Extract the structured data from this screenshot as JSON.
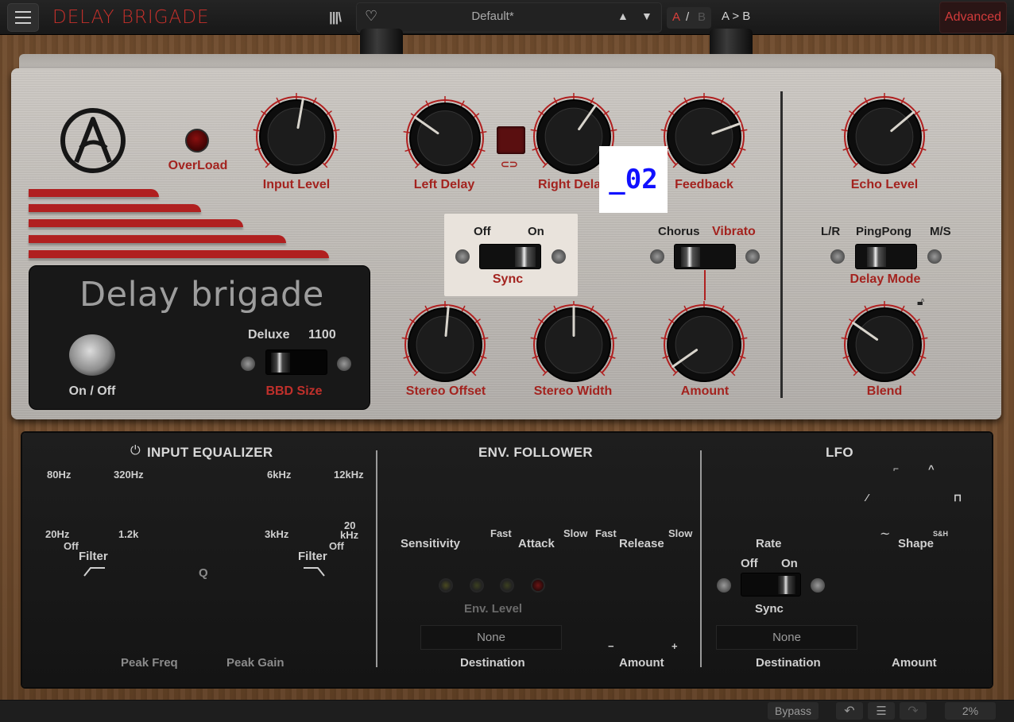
{
  "header": {
    "menu_icon": "hamburger-icon",
    "app_title": "DELAY BRIGADE",
    "library_icon": "library-icon",
    "favorite_icon": "heart-icon",
    "preset_name": "Default*",
    "prev_preset": "▲",
    "next_preset": "▼",
    "ab_a": "A",
    "ab_sep": "/",
    "ab_b": "B",
    "ab_copy": "A > B",
    "advanced": "Advanced"
  },
  "pedal": {
    "overload_label": "OverLoad",
    "input_level_label": "Input Level",
    "left_delay_label": "Left Delay",
    "right_delay_label": "Right Delay",
    "feedback_label": "Feedback",
    "echo_level_label": "Echo Level",
    "highlight_overlay": "_02",
    "sync": {
      "off": "Off",
      "on": "On",
      "label": "Sync"
    },
    "chorus": {
      "left": "Chorus",
      "right": "Vibrato"
    },
    "delay_mode": {
      "lr": "L/R",
      "pingpong": "PingPong",
      "ms": "M/S",
      "label": "Delay Mode"
    },
    "brand_title": "Delay brigade",
    "on_off_label": "On / Off",
    "bbd": {
      "deluxe": "Deluxe",
      "n1100": "1100",
      "label": "BBD Size"
    },
    "stereo_offset_label": "Stereo Offset",
    "stereo_width_label": "Stereo Width",
    "amount_label": "Amount",
    "blend_label": "Blend"
  },
  "input_eq": {
    "title": "INPUT EQUALIZER",
    "lo_80": "80Hz",
    "lo_320": "320Hz",
    "lo_20": "20Hz",
    "lo_off": "Off",
    "lo_12k": "1.2k",
    "lo_filter": "Filter",
    "q_label": "Q",
    "hi_6k": "6kHz",
    "hi_12k": "12kHz",
    "hi_3k": "3kHz",
    "hi_20": "20",
    "hi_khz": "kHz",
    "hi_off": "Off",
    "hi_filter": "Filter",
    "peak_freq": "Peak Freq",
    "peak_gain": "Peak Gain"
  },
  "env": {
    "title": "ENV. FOLLOWER",
    "sensitivity": "Sensitivity",
    "attack": "Attack",
    "release": "Release",
    "fast1": "Fast",
    "slow1": "Slow",
    "fast2": "Fast",
    "slow2": "Slow",
    "env_level": "Env. Level",
    "destination_value": "None",
    "destination_label": "Destination",
    "amount_label": "Amount",
    "minus": "−",
    "plus": "+"
  },
  "lfo": {
    "title": "LFO",
    "rate": "Rate",
    "shape": "Shape",
    "sh": "S&H",
    "sync_off": "Off",
    "sync_on": "On",
    "sync_label": "Sync",
    "destination_value": "None",
    "destination_label": "Destination",
    "amount_label": "Amount"
  },
  "status": {
    "bypass": "Bypass",
    "undo_icon": "undo-icon",
    "history_icon": "list-icon",
    "redo_icon": "redo-icon",
    "cpu": "2%"
  },
  "colors": {
    "accent": "#c6302b",
    "label_red": "#a3231f",
    "highlight_text": "#1010ff"
  }
}
